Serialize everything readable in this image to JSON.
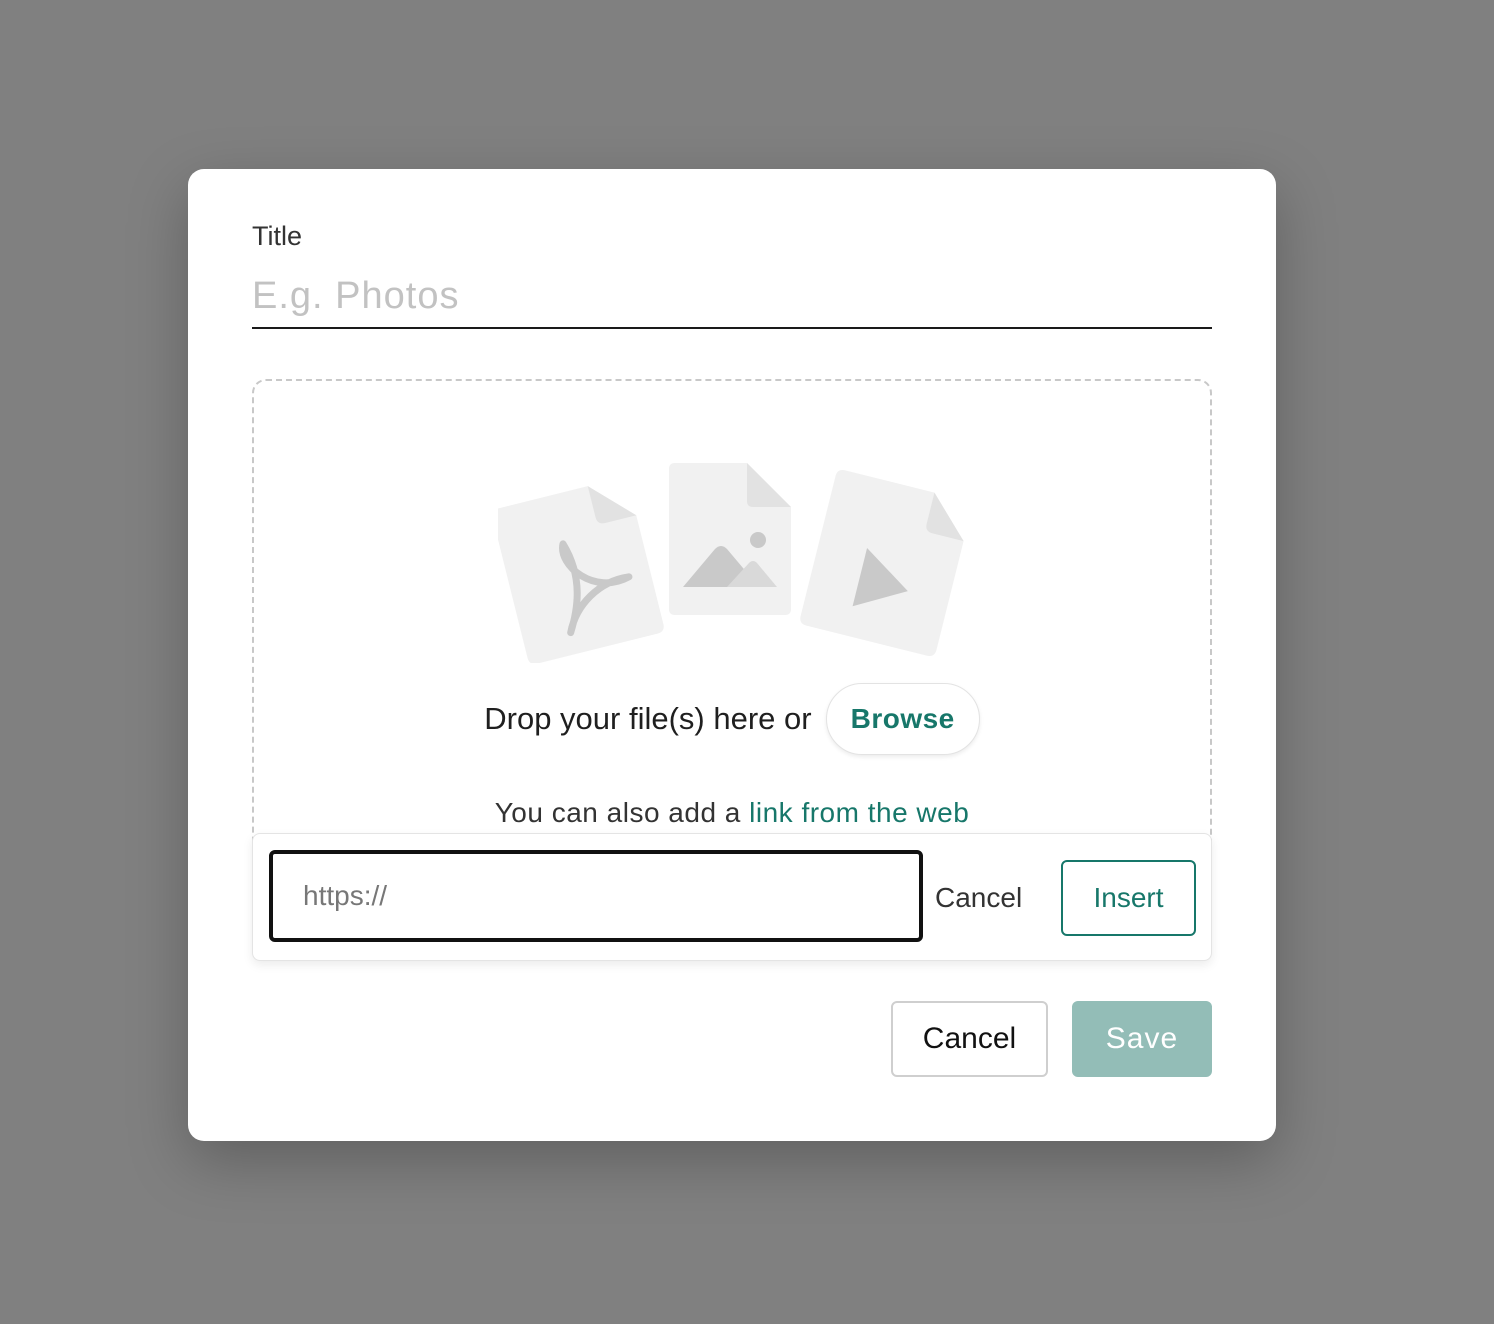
{
  "dialog": {
    "title_label": "Title",
    "title_placeholder": "E.g. Photos",
    "title_value": ""
  },
  "dropzone": {
    "drop_text": "Drop your file(s) here or",
    "browse_label": "Browse",
    "also_text": "You can also add a",
    "link_text": "link from the web",
    "illustration_icons": [
      "pdf-file-icon",
      "image-file-icon",
      "video-file-icon"
    ]
  },
  "link_panel": {
    "url_placeholder": "https://",
    "url_value": "",
    "cancel_label": "Cancel",
    "insert_label": "Insert"
  },
  "footer": {
    "cancel_label": "Cancel",
    "save_label": "Save",
    "save_disabled": true
  },
  "colors": {
    "accent": "#17776a",
    "save_disabled_bg": "#93bdb7",
    "overlay": "#808080"
  }
}
